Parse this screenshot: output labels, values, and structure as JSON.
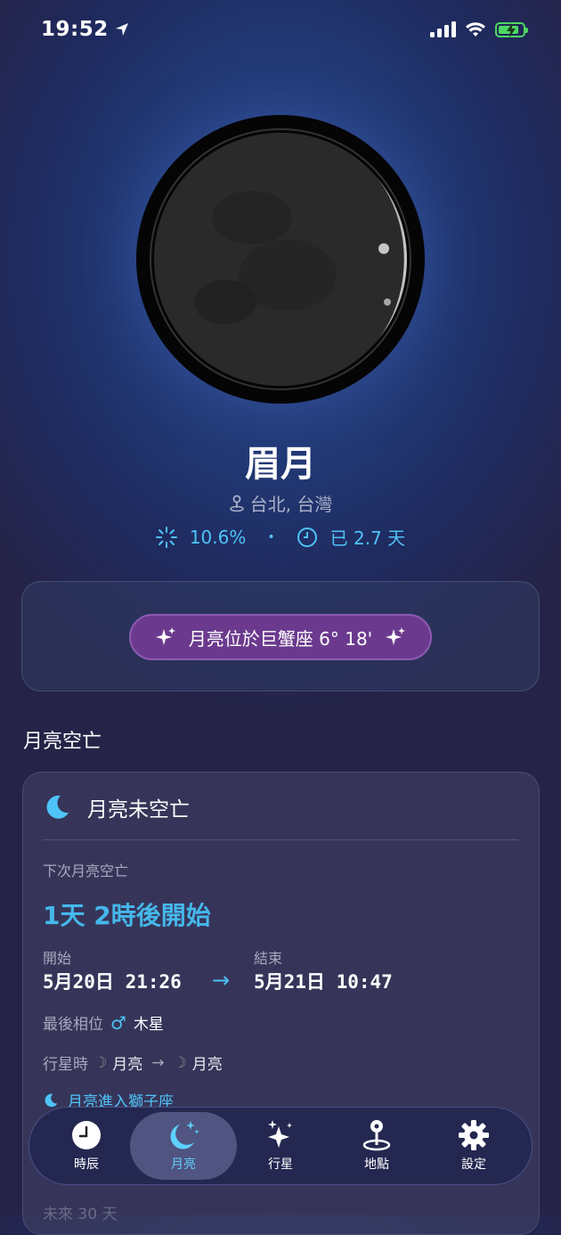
{
  "status_bar": {
    "time": "19:52"
  },
  "moon": {
    "phase_name": "眉月",
    "location": "台北, 台灣",
    "illumination": "10.6%",
    "separator": "•",
    "age": "已 2.7 天"
  },
  "zodiac": {
    "text": "月亮位於巨蟹座 6° 18'"
  },
  "void_of_course": {
    "section_title": "月亮空亡",
    "status": "月亮未空亡",
    "next_label": "下次月亮空亡",
    "countdown": "1天 2時後開始",
    "start_label": "開始",
    "start_value": "5月20日 21:26",
    "end_label": "結束",
    "end_value": "5月21日 10:47",
    "last_aspect_label": "最後相位",
    "last_aspect_symbol": "♂",
    "last_aspect_value": "木星",
    "planet_hour_label": "行星時",
    "planet_hour_from": "月亮",
    "planet_hour_to": "月亮",
    "moon_enter": "月亮進入獅子座",
    "next_30": "未來 30 天"
  },
  "tabs": [
    {
      "label": "時辰",
      "icon": "clock-icon"
    },
    {
      "label": "月亮",
      "icon": "moon-stars-icon"
    },
    {
      "label": "行星",
      "icon": "sparkles-icon"
    },
    {
      "label": "地點",
      "icon": "location-pin-icon"
    },
    {
      "label": "設定",
      "icon": "gear-icon"
    }
  ],
  "colors": {
    "accent": "#4fc3f7",
    "zodiac_pill": "#6b3a8e",
    "battery": "#4cd964"
  }
}
